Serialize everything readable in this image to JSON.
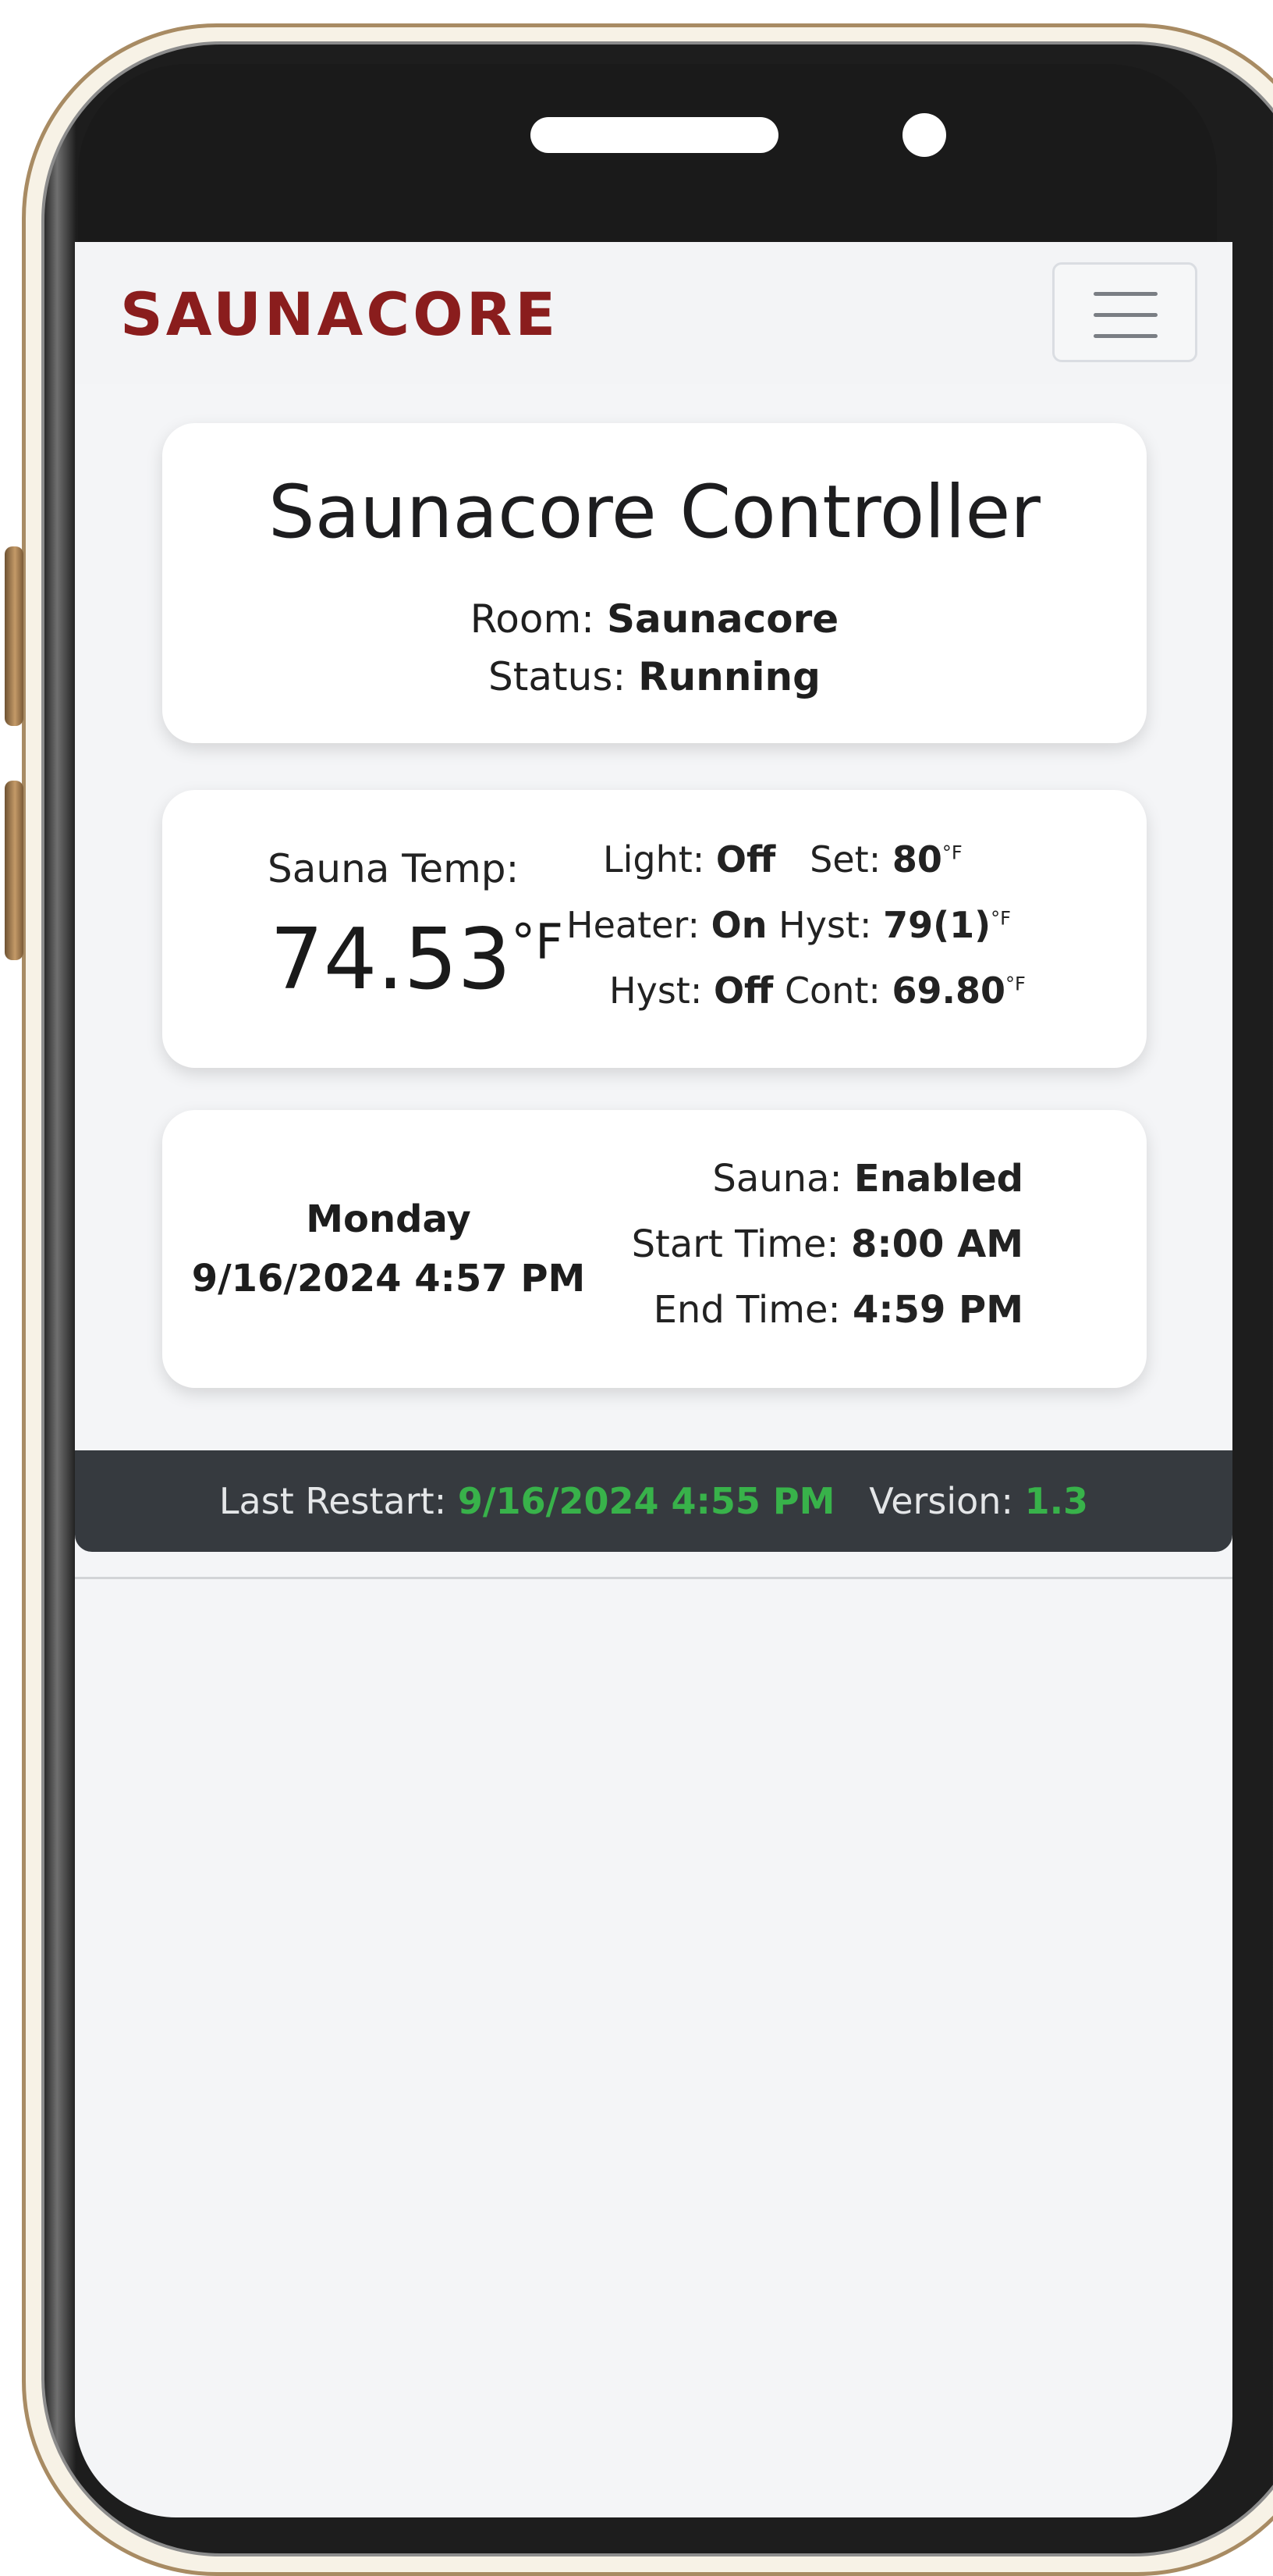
{
  "brand": {
    "logo_text": "SAUNACORE",
    "logo_color": "#8a1d1d"
  },
  "navbar": {
    "menu_icon": "hamburger-menu-icon"
  },
  "controller": {
    "title": "Saunacore Controller",
    "room_label": "Room:",
    "room_value": "Saunacore",
    "status_label": "Status:",
    "status_value": "Running"
  },
  "readings": {
    "temp_label": "Sauna Temp:",
    "temp_value": "74.53",
    "temp_unit": "°F",
    "light_label": "Light:",
    "light_value": "Off",
    "set_label": "Set:",
    "set_value": "80",
    "heater_label": "Heater:",
    "heater_value": "On",
    "hyst_label": "Hyst:",
    "hyst_value": "79(1)",
    "hyst2_label": "Hyst:",
    "hyst2_value": "Off",
    "cont_label": "Cont:",
    "cont_value": "69.80",
    "small_unit": "°F"
  },
  "schedule": {
    "day": "Monday",
    "datetime": "9/16/2024 4:57 PM",
    "sauna_label": "Sauna:",
    "sauna_value": "Enabled",
    "start_label": "Start Time:",
    "start_value": "8:00 AM",
    "end_label": "End Time:",
    "end_value": "4:59 PM"
  },
  "footer": {
    "restart_label": "Last Restart:",
    "restart_value": "9/16/2024 4:55 PM",
    "version_label": "Version:",
    "version_value": "1.3",
    "accent_color": "#38b24a"
  }
}
